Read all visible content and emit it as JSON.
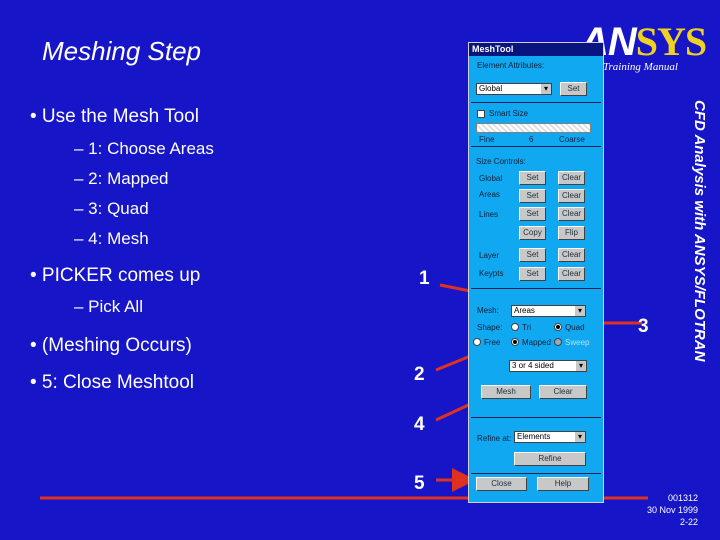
{
  "header": {
    "title": "Meshing Step",
    "logo": "ANSYS",
    "logo_an": "AN",
    "logo_sys": "SYS",
    "subtitle": "Training Manual",
    "side_title": "CFD Analysis with ANSYS/FLOTRAN"
  },
  "bullets": [
    {
      "text": "• Use the Mesh Tool",
      "sub": [
        "– 1: Choose Areas",
        "– 2: Mapped",
        "– 3: Quad",
        "– 4: Mesh"
      ]
    },
    {
      "text": "• PICKER comes up",
      "sub": [
        "– Pick All"
      ]
    },
    {
      "text": "• (Meshing Occurs)"
    },
    {
      "text": "• 5: Close Meshtool"
    }
  ],
  "callouts": [
    "1",
    "2",
    "3",
    "4",
    "5"
  ],
  "meshtool": {
    "title": "MeshTool",
    "element_attributes": "Element Attributes:",
    "attr_value": "Global",
    "set": "Set",
    "smart_size": "Smart Size",
    "fine": "Fine",
    "size_value": "6",
    "coarse": "Coarse",
    "size_controls": "Size Controls:",
    "rows": [
      {
        "label": "Global",
        "a": "Set",
        "b": "Clear"
      },
      {
        "label": "Areas",
        "a": "Set",
        "b": "Clear"
      },
      {
        "label": "Lines",
        "a": "Set",
        "b": "Clear"
      },
      {
        "label": "",
        "a": "Copy",
        "b": "Flip"
      },
      {
        "label": "Layer",
        "a": "Set",
        "b": "Clear"
      },
      {
        "label": "Keypts",
        "a": "Set",
        "b": "Clear"
      }
    ],
    "mesh_label": "Mesh:",
    "mesh_value": "Areas",
    "shape_label": "Shape:",
    "tri": "Tri",
    "quad": "Quad",
    "free": "Free",
    "mapped": "Mapped",
    "sweep": "Sweep",
    "sided_value": "3 or 4 sided",
    "mesh_btn": "Mesh",
    "clear_btn": "Clear",
    "refine_label": "Refine at:",
    "refine_value": "Elements",
    "refine_btn": "Refine",
    "close_btn": "Close",
    "help_btn": "Help"
  },
  "footer": {
    "code": "001312",
    "date": "30 Nov 1999",
    "page": "2-22"
  },
  "colors": {
    "background": "#1616c8",
    "panel": "#10a8f0",
    "arrow": "#e03020",
    "logo_yellow": "#f0d020"
  }
}
